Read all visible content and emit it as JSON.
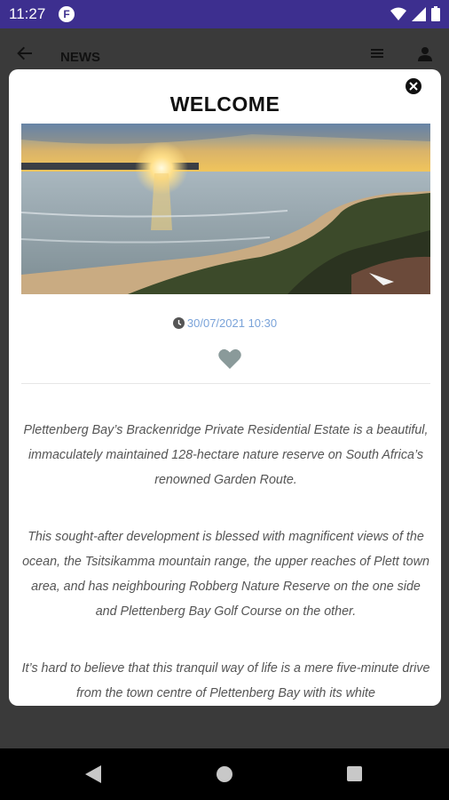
{
  "status_bar": {
    "time": "11:27",
    "app_icon": "F"
  },
  "app_bar": {
    "title": "NEWS"
  },
  "modal": {
    "title": "WELCOME",
    "date": "30/07/2021 10:30",
    "paragraphs": [
      "Plettenberg Bay’s Brackenridge Private Residential Estate is a beautiful, immaculately maintained 128-hectare nature reserve on South Africa’s renowned Garden Route.",
      "This sought-after development is blessed with magnificent views of the ocean, the Tsitsikamma mountain range, the upper reaches of Plett town area, and has neighbouring Robberg Nature Reserve on the one side and Plettenberg Bay Golf Course on the other.",
      "It’s hard to believe that this tranquil way of life is a mere five-minute drive from the town centre of Plettenberg Bay with its white"
    ]
  },
  "colors": {
    "status_bar": "#3d2f8f",
    "date_text": "#7aa3d9",
    "heart": "#8a9a9a"
  },
  "icons": [
    "wifi-icon",
    "signal-icon",
    "battery-icon",
    "back-arrow-icon",
    "menu-icon",
    "user-icon",
    "close-icon",
    "clock-icon",
    "heart-icon"
  ]
}
